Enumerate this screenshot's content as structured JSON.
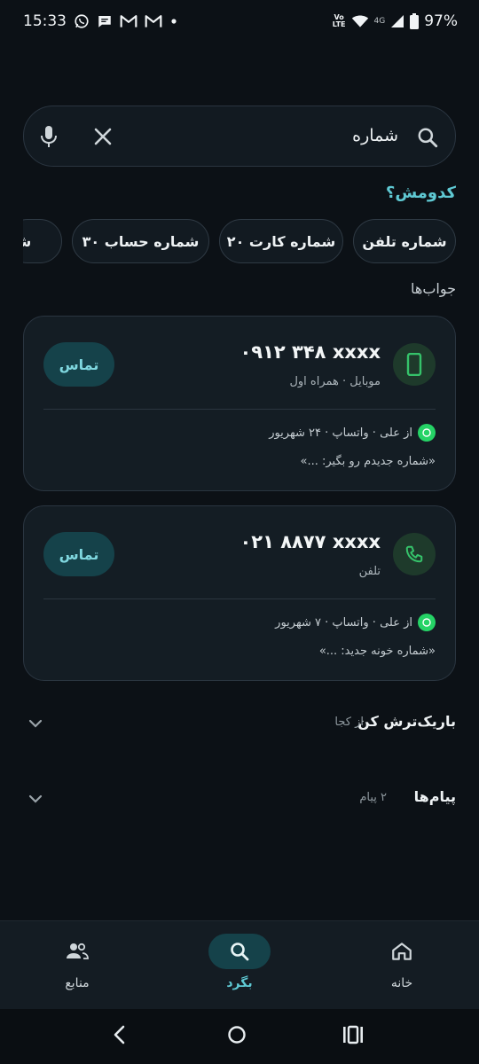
{
  "status_bar": {
    "time": "15:33",
    "notification_icons": [
      "whatsapp-icon",
      "message-icon",
      "gmail-icon",
      "gmail-icon",
      "dot"
    ],
    "volte_top": "Vo",
    "volte_bottom": "LTE",
    "network": "4G",
    "battery": "97%"
  },
  "search": {
    "query": "شماره"
  },
  "which_prompt": "کدومش؟",
  "chips": [
    {
      "label": "شماره تلفن"
    },
    {
      "label": "شماره کارت ۲۰"
    },
    {
      "label": "شماره حساب ۳۰"
    },
    {
      "label": "شبا"
    }
  ],
  "answers_title": "جواب‌ها",
  "results": [
    {
      "number": "۰۹۱۲ ۳۴۸ xxxx",
      "carrier": "موبایل · همراه اول",
      "call_label": "تماس",
      "source": "از علی · واتساپ · ۲۴ شهریور",
      "quote": "«شماره جدیدم رو بگیر: ...»",
      "type_icon": "mobile-phone-icon"
    },
    {
      "number": "۰۲۱ ۸۸۷۷ xxxx",
      "carrier": "تلفن",
      "call_label": "تماس",
      "source": "از علی · واتساپ · ۷ شهریور",
      "quote": "«شماره خونه جدید: ...»",
      "type_icon": "landline-phone-icon"
    }
  ],
  "filters": [
    {
      "title": "باریک‌ترش کن",
      "subtitle": "از کجا"
    },
    {
      "title": "پیام‌ها",
      "subtitle": "۲ پیام"
    }
  ],
  "bottom_nav": [
    {
      "label": "خانه",
      "icon": "home-icon"
    },
    {
      "label": "بگرد",
      "icon": "search-icon",
      "active": true
    },
    {
      "label": "منابع",
      "icon": "people-icon"
    }
  ],
  "colors": {
    "background": "#0c1116",
    "accent": "#5fc9d3",
    "whatsapp": "#25d366",
    "call_button_bg": "#15424a"
  }
}
